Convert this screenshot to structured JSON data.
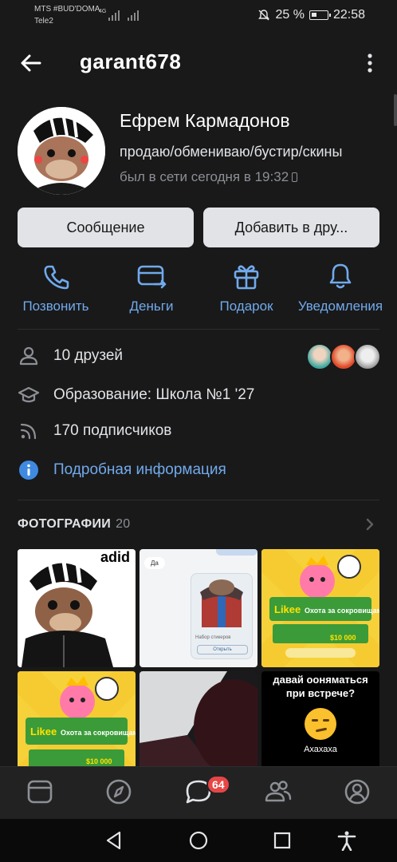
{
  "status_bar": {
    "carrier_1": "MTS #BUD'DOMA",
    "carrier_2": "Tele2",
    "network": "4G",
    "battery": "25 %",
    "time": "22:58"
  },
  "header": {
    "title": "garant678"
  },
  "profile": {
    "name": "Ефрем Кармадонов",
    "status": "продаю/обмениваю/бустир/скины",
    "last_seen": "был в сети сегодня в 19:32"
  },
  "buttons": {
    "message": "Сообщение",
    "add_friend": "Добавить в дру..."
  },
  "actions": [
    {
      "label": "Позвонить",
      "icon": "phone-icon"
    },
    {
      "label": "Деньги",
      "icon": "money-icon"
    },
    {
      "label": "Подарок",
      "icon": "gift-icon"
    },
    {
      "label": "Уведомления",
      "icon": "bell-icon"
    }
  ],
  "info": {
    "friends": "10 друзей",
    "education": "Образование: Школа №1 '27",
    "followers": "170 подписчиков",
    "details": "Подробная информация"
  },
  "photos": {
    "title": "ФОТОГРАФИИ",
    "count": "20",
    "tile2_text": "Да",
    "tile2_caption": "Набор стикеров",
    "tile2_button": "Открыть",
    "likee_logo": "Likee",
    "likee_title": "Охота за сокровищами",
    "likee_prize": "$10 000",
    "tile6_text_1": "давай ооняматься",
    "tile6_text_2": "при встрече?",
    "tile6_text_3": "Ахахаха",
    "tile1_text": "adid"
  },
  "tabbar": {
    "badge": "64",
    "tabs": [
      "feed-icon",
      "discover-icon",
      "messages-icon",
      "friends-icon",
      "profile-icon"
    ]
  },
  "colors": {
    "background": "#19191a",
    "accent": "#71aaeb",
    "badge": "#e64646"
  }
}
